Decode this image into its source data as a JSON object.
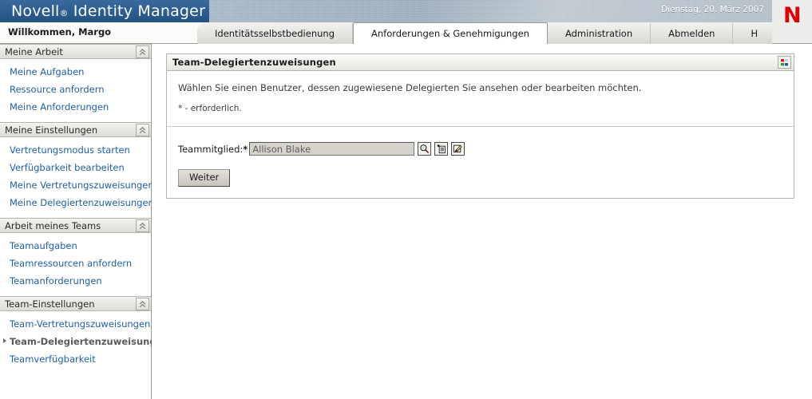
{
  "header": {
    "brand_novell": "Novell",
    "brand_reg": "®",
    "brand_product": "Identity Manager",
    "date": "Dienstag, 20. März 2007",
    "logo_letter": "N",
    "logo_color": "#e00000",
    "banner_blue": "#2e6296",
    "welcome": "Willkommen, Margo"
  },
  "tabs": [
    {
      "label": "Identitätsselbstbedienung",
      "active": false
    },
    {
      "label": "Anforderungen & Genehmigungen",
      "active": true
    },
    {
      "label": "Administration",
      "active": false
    },
    {
      "label": "Abmelden",
      "active": false
    },
    {
      "label": "Hilfe",
      "active": false
    }
  ],
  "sidebar": {
    "sections": [
      {
        "title": "Meine Arbeit",
        "collapse_icon": "chevron-double-up-icon",
        "items": [
          {
            "label": "Meine Aufgaben",
            "active": false
          },
          {
            "label": "Ressource anfordern",
            "active": false
          },
          {
            "label": "Meine Anforderungen",
            "active": false
          }
        ]
      },
      {
        "title": "Meine Einstellungen",
        "collapse_icon": "chevron-double-up-icon",
        "items": [
          {
            "label": "Vertretungsmodus starten",
            "active": false
          },
          {
            "label": "Verfügbarkeit bearbeiten",
            "active": false
          },
          {
            "label": "Meine Vertretungszuweisungen",
            "active": false
          },
          {
            "label": "Meine Delegiertenzuweisungen",
            "active": false
          }
        ]
      },
      {
        "title": "Arbeit meines Teams",
        "collapse_icon": "chevron-double-up-icon",
        "items": [
          {
            "label": "Teamaufgaben",
            "active": false
          },
          {
            "label": "Teamressourcen anfordern",
            "active": false
          },
          {
            "label": "Teamanforderungen",
            "active": false
          }
        ]
      },
      {
        "title": "Team-Einstellungen",
        "collapse_icon": "chevron-double-up-icon",
        "items": [
          {
            "label": "Team-Vertretungszuweisungen",
            "active": false
          },
          {
            "label": "Team-Delegiertenzuweisungen",
            "active": true
          },
          {
            "label": "Teamverfügbarkeit",
            "active": false
          }
        ]
      }
    ]
  },
  "panel": {
    "title": "Team-Delegiertenzuweisungen",
    "grid_icon": "color-grid-icon",
    "intro": "Wählen Sie einen Benutzer, dessen zugewiesene Delegierten Sie ansehen oder bearbeiten möchten.",
    "required_note": "* - erforderlich.",
    "form": {
      "label": "Teammitglied:",
      "label_required_marker": "*",
      "input_value": "Allison Blake",
      "input_placeholder": "Allison Blake",
      "icons": [
        {
          "name": "search-icon",
          "title": "Suchen"
        },
        {
          "name": "history-add-icon",
          "title": "Verlauf"
        },
        {
          "name": "edit-pencil-icon",
          "title": "Bearbeiten"
        }
      ]
    },
    "submit_label": "Weiter"
  }
}
